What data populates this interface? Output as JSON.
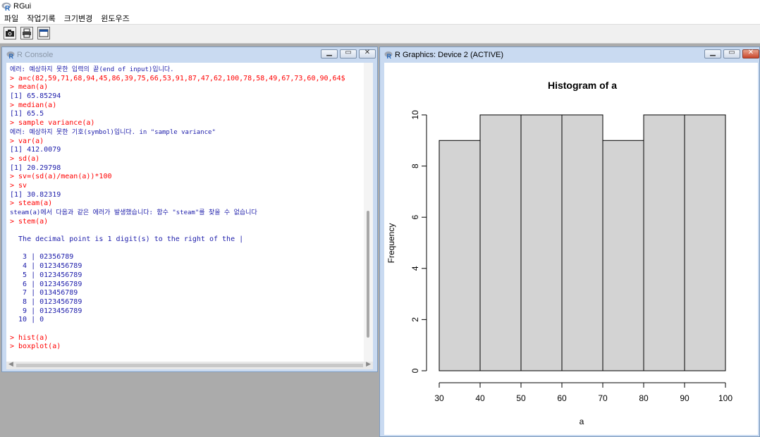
{
  "app": {
    "title": "RGui",
    "icon": "r-logo-icon"
  },
  "menu": [
    "파일",
    "작업기록",
    "크기변경",
    "윈도우즈"
  ],
  "toolbar": [
    {
      "name": "camera-icon"
    },
    {
      "name": "printer-icon"
    },
    {
      "name": "window-icon"
    }
  ],
  "console": {
    "title": "R Console",
    "lines": [
      {
        "text": "에러: 예상하지 못한 입력의 끝(end of input)입니다.",
        "kind": "error"
      },
      {
        "text": "> a=c(82,59,71,68,94,45,86,39,75,66,53,91,87,47,62,100,78,58,49,67,73,60,90,64$",
        "kind": "input"
      },
      {
        "text": "> mean(a)",
        "kind": "input"
      },
      {
        "text": "[1] 65.85294",
        "kind": "output"
      },
      {
        "text": "> median(a)",
        "kind": "input"
      },
      {
        "text": "[1] 65.5",
        "kind": "output"
      },
      {
        "text": "> sample variance(a)",
        "kind": "input"
      },
      {
        "text": "에러: 예상하지 못한 기호(symbol)입니다. in \"sample variance\"",
        "kind": "error"
      },
      {
        "text": "> var(a)",
        "kind": "input"
      },
      {
        "text": "[1] 412.0079",
        "kind": "output"
      },
      {
        "text": "> sd(a)",
        "kind": "input"
      },
      {
        "text": "[1] 20.29798",
        "kind": "output"
      },
      {
        "text": "> sv=(sd(a)/mean(a))*100",
        "kind": "input"
      },
      {
        "text": "> sv",
        "kind": "input"
      },
      {
        "text": "[1] 30.82319",
        "kind": "output"
      },
      {
        "text": "> steam(a)",
        "kind": "input"
      },
      {
        "text": "steam(a)에서 다음과 같은 에러가 발생했습니다: 함수 \"steam\"를 찾을 수 없습니다",
        "kind": "error"
      },
      {
        "text": "> stem(a)",
        "kind": "input"
      },
      {
        "text": "",
        "kind": "output"
      },
      {
        "text": "  The decimal point is 1 digit(s) to the right of the |",
        "kind": "output"
      },
      {
        "text": "",
        "kind": "output"
      },
      {
        "text": "   3 | 02356789",
        "kind": "output"
      },
      {
        "text": "   4 | 0123456789",
        "kind": "output"
      },
      {
        "text": "   5 | 0123456789",
        "kind": "output"
      },
      {
        "text": "   6 | 0123456789",
        "kind": "output"
      },
      {
        "text": "   7 | 013456789",
        "kind": "output"
      },
      {
        "text": "   8 | 0123456789",
        "kind": "output"
      },
      {
        "text": "   9 | 0123456789",
        "kind": "output"
      },
      {
        "text": "  10 | 0",
        "kind": "output"
      },
      {
        "text": "",
        "kind": "output"
      },
      {
        "text": "> hist(a)",
        "kind": "input"
      },
      {
        "text": "> boxplot(a)",
        "kind": "input"
      }
    ]
  },
  "graphics": {
    "title": "R Graphics: Device 2 (ACTIVE)"
  },
  "colors": {
    "input": "#ff0000",
    "output": "#1c1caa",
    "bar_fill": "#d3d3d3",
    "bar_stroke": "#000000"
  },
  "chart_data": {
    "type": "bar",
    "title": "Histogram of a",
    "xlabel": "a",
    "ylabel": "Frequency",
    "bins": [
      [
        30,
        40
      ],
      [
        40,
        50
      ],
      [
        50,
        60
      ],
      [
        60,
        70
      ],
      [
        70,
        80
      ],
      [
        80,
        90
      ],
      [
        90,
        100
      ]
    ],
    "values": [
      9,
      10,
      10,
      10,
      9,
      10,
      10
    ],
    "xticks": [
      30,
      40,
      50,
      60,
      70,
      80,
      90,
      100
    ],
    "yticks": [
      0,
      2,
      4,
      6,
      8,
      10
    ],
    "xlim": [
      30,
      100
    ],
    "ylim": [
      0,
      10
    ],
    "grid": false
  }
}
